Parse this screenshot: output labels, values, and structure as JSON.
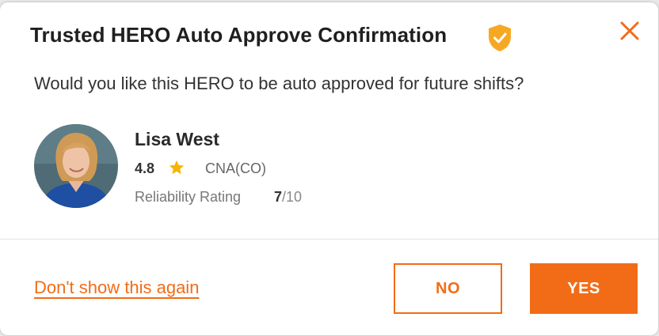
{
  "dialog": {
    "title": "Trusted HERO Auto Approve Confirmation",
    "question": "Would you like this HERO to be auto approved for future shifts?",
    "close_icon": "close-icon",
    "badge_icon": "shield-check-icon"
  },
  "hero": {
    "name": "Lisa West",
    "rating": "4.8",
    "rating_icon": "star-icon",
    "certification": "CNA(CO)",
    "reliability_label": "Reliability Rating",
    "reliability_score": "7",
    "reliability_max": "/10"
  },
  "footer": {
    "dont_show_label": "Don't show this again",
    "no_label": "NO",
    "yes_label": "YES"
  },
  "colors": {
    "accent": "#f26c17",
    "shield": "#f7a823",
    "star": "#f7b500"
  }
}
